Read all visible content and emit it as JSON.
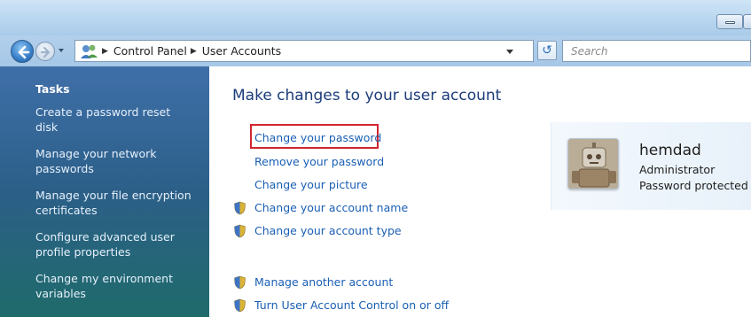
{
  "window": {
    "accent": "#b9d6ef"
  },
  "navigation": {
    "back_icon": "back-arrow-icon",
    "forward_icon": "forward-arrow-icon"
  },
  "address": {
    "icon": "user-accounts-icon",
    "breadcrumbs": [
      "Control Panel",
      "User Accounts"
    ]
  },
  "search": {
    "placeholder": "Search"
  },
  "sidebar": {
    "title": "Tasks",
    "items": [
      {
        "label": "Create a password reset disk"
      },
      {
        "label": "Manage your network passwords"
      },
      {
        "label": "Manage your file encryption certificates"
      },
      {
        "label": "Configure advanced user profile properties"
      },
      {
        "label": "Change my environment variables"
      }
    ]
  },
  "main": {
    "heading": "Make changes to your user account",
    "links": [
      {
        "label": "Change your password",
        "icon": null,
        "highlighted": true
      },
      {
        "label": "Remove your password",
        "icon": null
      },
      {
        "label": "Change your picture",
        "icon": null
      },
      {
        "label": "Change your account name",
        "icon": "uac-shield-icon"
      },
      {
        "label": "Change your account type",
        "icon": "uac-shield-icon"
      },
      {
        "label": "Manage another account",
        "icon": "uac-shield-icon"
      },
      {
        "label": "Turn User Account Control on or off",
        "icon": "uac-shield-icon"
      }
    ],
    "highlight_color": "#d0252f",
    "link_color": "#1a5fb4"
  },
  "user": {
    "name": "hemdad",
    "role": "Administrator",
    "status": "Password protected",
    "avatar_icon": "user-avatar-picture"
  }
}
